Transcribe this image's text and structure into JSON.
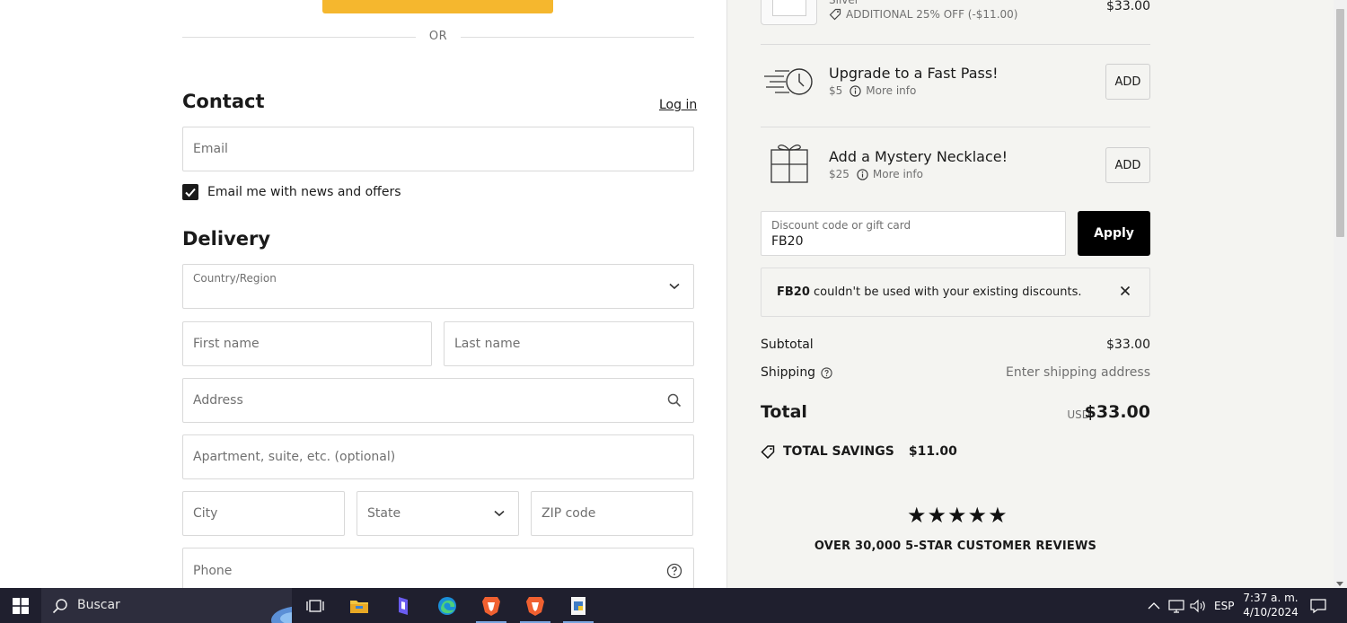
{
  "checkout": {
    "or_label": "OR",
    "contact": {
      "title": "Contact",
      "login_label": "Log in",
      "email_placeholder": "Email",
      "newsletter_label": "Email me with news and offers",
      "newsletter_checked": true
    },
    "delivery": {
      "title": "Delivery",
      "country_label": "Country/Region",
      "country_value": "",
      "first_name_placeholder": "First name",
      "last_name_placeholder": "Last name",
      "address_placeholder": "Address",
      "apartment_placeholder": "Apartment, suite, etc. (optional)",
      "city_placeholder": "City",
      "state_placeholder": "State",
      "zip_placeholder": "ZIP code",
      "phone_placeholder": "Phone"
    }
  },
  "summary": {
    "item": {
      "variant": "Silver",
      "discount_text": "ADDITIONAL 25% OFF (-$11.00)",
      "price": "$33.00"
    },
    "upsells": [
      {
        "title": "Upgrade to a Fast Pass!",
        "price": "$5",
        "more_info": "More info",
        "add_label": "ADD",
        "icon": "fast-clock-icon"
      },
      {
        "title": "Add a Mystery Necklace!",
        "price": "$25",
        "more_info": "More info",
        "add_label": "ADD",
        "icon": "gift-box-icon"
      }
    ],
    "discount": {
      "label": "Discount code or gift card",
      "value": "FB20",
      "apply_label": "Apply"
    },
    "notice": {
      "code": "FB20",
      "message": " couldn't be used with your existing discounts."
    },
    "subtotal_label": "Subtotal",
    "subtotal_value": "$33.00",
    "shipping_label": "Shipping",
    "shipping_value": "Enter shipping address",
    "total_label": "Total",
    "total_currency": "USD",
    "total_value": "$33.00",
    "savings_label": "TOTAL SAVINGS",
    "savings_value": "$11.00",
    "rating_stars": 5,
    "reviews_text": "OVER 30,000 5-STAR CUSTOMER REVIEWS"
  },
  "taskbar": {
    "search_text": "Buscar",
    "language": "ESP",
    "time": "7:37 a. m.",
    "date": "4/10/2024"
  },
  "colors": {
    "accent_button": "#f5b72e",
    "apply_button": "#000000",
    "summary_bg": "#f4f4f1",
    "taskbar_bg": "#1f1f2e"
  }
}
